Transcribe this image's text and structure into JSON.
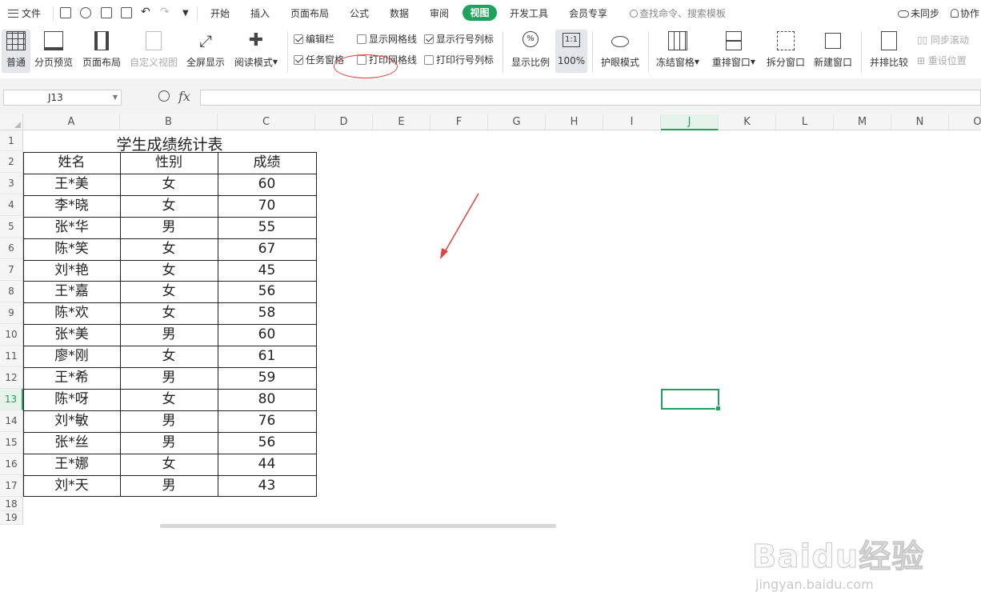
{
  "menubar": {
    "file_label": "文件",
    "tabs": [
      {
        "label": "开始"
      },
      {
        "label": "插入"
      },
      {
        "label": "页面布局"
      },
      {
        "label": "公式"
      },
      {
        "label": "数据"
      },
      {
        "label": "审阅"
      },
      {
        "label": "视图"
      },
      {
        "label": "开发工具"
      },
      {
        "label": "会员专享"
      }
    ],
    "search_placeholder": "查找命令、搜索模板",
    "sync_label": "未同步",
    "collab_label": "协作"
  },
  "ribbon": {
    "normal": "普通",
    "page_preview": "分页预览",
    "page_layout": "页面布局",
    "custom_view": "自定义视图",
    "fullscreen": "全屏显示",
    "reading_mode": "阅读模式",
    "edit_bar": "编辑栏",
    "show_gridlines": "显示网格线",
    "show_headers": "显示行号列标",
    "task_pane": "任务窗格",
    "print_gridlines": "打印网格线",
    "print_headers": "打印行号列标",
    "zoom": "显示比例",
    "zoom_100_icon": "1:1",
    "zoom_100": "100%",
    "eye_mode": "护眼模式",
    "freeze": "冻结窗格",
    "arrange": "重排窗口",
    "split": "拆分窗口",
    "new_window": "新建窗口",
    "compare": "并排比较",
    "sync_scroll": "同步滚动",
    "reset_pos": "重设位置"
  },
  "formula_bar": {
    "cell_ref": "J13",
    "fx": "fx",
    "value": ""
  },
  "columns": [
    "A",
    "B",
    "C",
    "D",
    "E",
    "F",
    "G",
    "H",
    "I",
    "J",
    "K",
    "L",
    "M",
    "N",
    "O"
  ],
  "rows": [
    "1",
    "2",
    "3",
    "4",
    "5",
    "6",
    "7",
    "8",
    "9",
    "10",
    "11",
    "12",
    "13",
    "14",
    "15",
    "16",
    "17",
    "18",
    "19"
  ],
  "sheet": {
    "title": "学生成绩统计表",
    "headers": [
      "姓名",
      "性别",
      "成绩"
    ],
    "records": [
      {
        "name": "王*美",
        "gender": "女",
        "score": "60"
      },
      {
        "name": "李*晓",
        "gender": "女",
        "score": "70"
      },
      {
        "name": "张*华",
        "gender": "男",
        "score": "55"
      },
      {
        "name": "陈*笑",
        "gender": "女",
        "score": "67"
      },
      {
        "name": "刘*艳",
        "gender": "女",
        "score": "45"
      },
      {
        "name": "王*嘉",
        "gender": "女",
        "score": "56"
      },
      {
        "name": "陈*欢",
        "gender": "女",
        "score": "58"
      },
      {
        "name": "张*美",
        "gender": "男",
        "score": "60"
      },
      {
        "name": "廖*刚",
        "gender": "女",
        "score": "61"
      },
      {
        "name": "王*希",
        "gender": "男",
        "score": "59"
      },
      {
        "name": "陈*呀",
        "gender": "女",
        "score": "80"
      },
      {
        "name": "刘*敏",
        "gender": "男",
        "score": "76"
      },
      {
        "name": "张*丝",
        "gender": "男",
        "score": "56"
      },
      {
        "name": "王*娜",
        "gender": "女",
        "score": "44"
      },
      {
        "name": "刘*天",
        "gender": "男",
        "score": "43"
      }
    ]
  },
  "watermark": {
    "brand": "Baidu经验",
    "url": "jingyan.baidu.com"
  },
  "colors": {
    "accent": "#1fa25e",
    "annotation": "#e0443e"
  }
}
